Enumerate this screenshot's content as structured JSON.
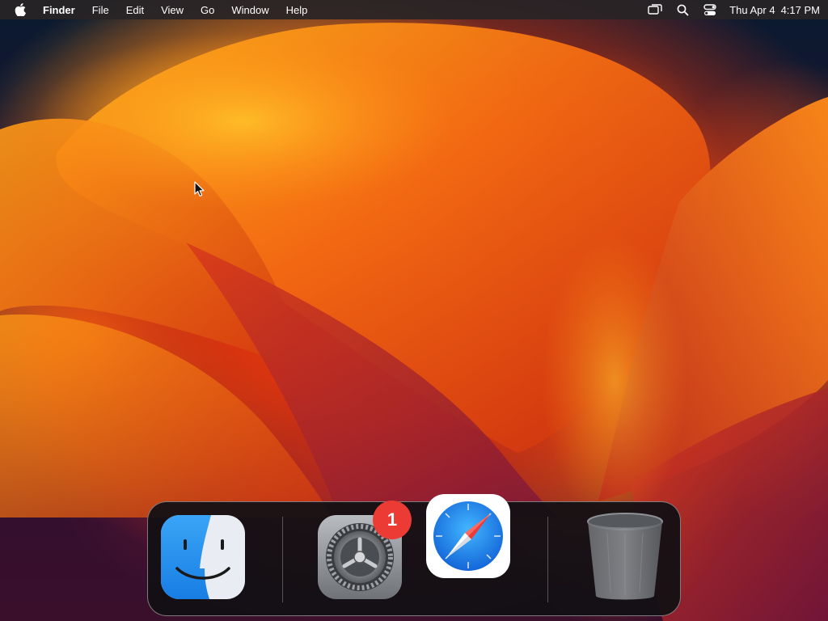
{
  "menubar": {
    "app_name": "Finder",
    "menus": [
      "File",
      "Edit",
      "View",
      "Go",
      "Window",
      "Help"
    ],
    "status_icons": [
      "screen-mirroring-icon",
      "spotlight-search-icon",
      "control-center-icon"
    ],
    "clock": {
      "date": "Thu Apr 4",
      "time": "4:17 PM"
    }
  },
  "dock": {
    "apps": [
      {
        "name": "Finder",
        "icon": "finder-icon",
        "running": true
      },
      {
        "name": "System Settings",
        "icon": "system-settings-icon",
        "badge": "1"
      },
      {
        "name": "Safari",
        "icon": "safari-icon"
      },
      {
        "name": "Trash",
        "icon": "trash-icon"
      }
    ]
  },
  "colors": {
    "menubar_bg": "#2a2628",
    "badge_red": "#ec3b35",
    "finder_blue": "#1e8ff0",
    "safari_blue": "#2c8cf0"
  }
}
